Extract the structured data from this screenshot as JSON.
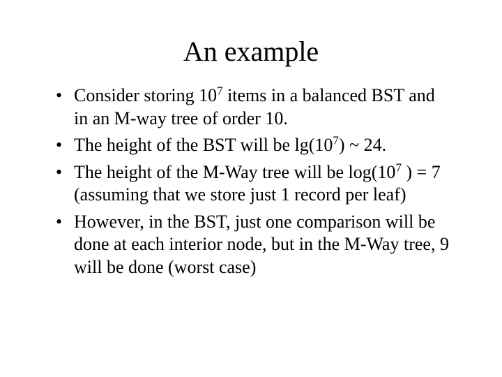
{
  "title": "An example",
  "bullets": [
    {
      "parts": [
        {
          "text": "Consider storing 10"
        },
        {
          "text": "7",
          "sup": true
        },
        {
          "text": " items in a balanced BST and in an M-way tree of order 10."
        }
      ]
    },
    {
      "parts": [
        {
          "text": "The height of the BST will be lg(10"
        },
        {
          "text": "7",
          "sup": true
        },
        {
          "text": ") ~ 24."
        }
      ]
    },
    {
      "parts": [
        {
          "text": "The height of the M-Way tree will be log(10"
        },
        {
          "text": "7",
          "sup": true
        },
        {
          "text": " ) = 7 (assuming that we store just 1 record per leaf)"
        }
      ]
    },
    {
      "parts": [
        {
          "text": "However, in the BST, just one comparison will be done at each interior node, but in the M-Way tree, 9 will be done (worst case)"
        }
      ]
    }
  ]
}
